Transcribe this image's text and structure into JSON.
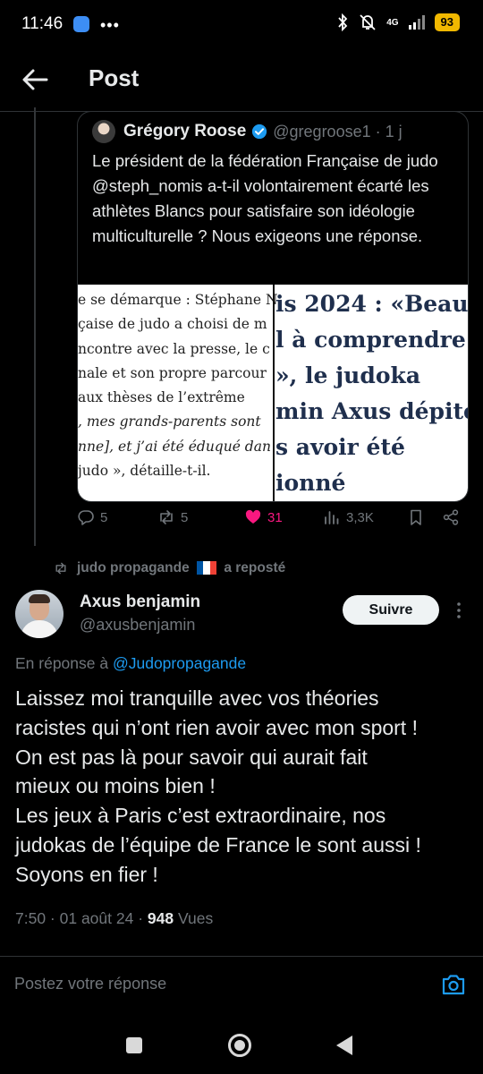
{
  "status_bar": {
    "time": "11:46",
    "dots": "•••",
    "network": "4G",
    "battery": "93"
  },
  "header": {
    "title": "Post"
  },
  "quoted_post": {
    "author_name": "Grégory Roose",
    "handle_time": "@gregroose1 · 1 j",
    "text": "Le président de la fédération Française de judo @steph_nomis a-t-il volontairement écarté les athlètes Blancs pour satisfaire son idéologie multiculturelle ? Nous exigeons une réponse.",
    "image_left_lines": [
      "e se démarque : Stéphane N",
      "çaise de judo a choisi de m",
      "ncontre avec la presse, le c",
      "nale et son propre parcour",
      " aux thèses de l’extrême",
      ", mes grands-parents sont",
      "nne], et j’ai été éduqué dan",
      "judo », détaille-t-il."
    ],
    "image_right_lines": [
      "is 2024 : «Beauc",
      "l à comprendre",
      "», le judoka",
      "min Axus dépité",
      "s avoir été",
      "ionné"
    ]
  },
  "actions": {
    "replies": "5",
    "reposts": "5",
    "likes": "31",
    "views": "3,3K"
  },
  "repost_banner": {
    "name": "judo propagande",
    "suffix": "a reposté"
  },
  "post": {
    "author_name": "Axus benjamin",
    "handle": "@axusbenjamin",
    "follow_label": "Suivre",
    "reply_prefix": "En réponse à ",
    "reply_mention": "@Judopropagande",
    "body_lines": [
      "Laissez moi tranquille avec vos théories",
      "racistes qui n’ont rien avoir avec mon sport !",
      "On est pas là pour savoir qui aurait fait",
      "mieux ou moins bien !",
      "Les jeux à Paris c’est extraordinaire, nos",
      "judokas de l’équipe de France le sont aussi !",
      "Soyons en fier !"
    ],
    "time_date": "7:50 · 01 août 24 · ",
    "views_count": "948",
    "views_label": " Vues"
  },
  "reply": {
    "placeholder": "Postez votre réponse"
  },
  "colors": {
    "background": "#000000",
    "accent": "#1d9bf0",
    "like": "#f91880",
    "muted": "#71767b"
  },
  "icons": [
    "back-arrow-icon",
    "verified-icon",
    "reply-icon",
    "repost-icon",
    "heart-icon",
    "views-icon",
    "bookmark-icon",
    "share-icon",
    "more-icon",
    "camera-icon"
  ]
}
